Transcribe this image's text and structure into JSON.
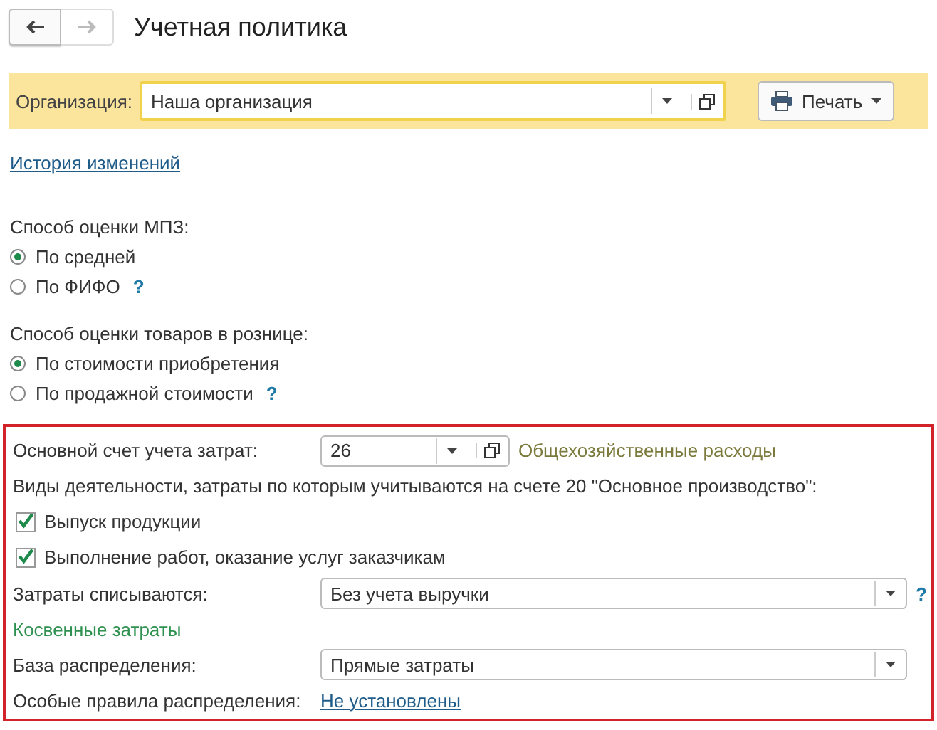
{
  "nav_buttons": [
    {
      "kind": "back",
      "disabled": false
    },
    {
      "kind": "forward",
      "disabled": true
    }
  ],
  "title": "Учетная политика",
  "organization": {
    "label": "Организация:",
    "value": "Наша организация"
  },
  "print_button": "Печать",
  "history_link": "История изменений",
  "inventory_valuation": {
    "label": "Способ оценки МПЗ:",
    "options": [
      {
        "label": "По средней",
        "selected": true
      },
      {
        "label": "По ФИФО",
        "selected": false,
        "help": "?"
      }
    ]
  },
  "retail_valuation": {
    "label": "Способ оценки товаров в рознице:",
    "options": [
      {
        "label": "По стоимости приобретения",
        "selected": true
      },
      {
        "label": "По продажной стоимости",
        "selected": false,
        "help": "?"
      }
    ]
  },
  "costs": {
    "main_account": {
      "label": "Основной счет учета затрат:",
      "value": "26",
      "description": "Общехозяйственные расходы"
    },
    "activities_label": "Виды деятельности, затраты по которым учитываются на счете 20 \"Основное производство\":",
    "activities": [
      {
        "label": "Выпуск продукции",
        "checked": true
      },
      {
        "label": "Выполнение работ, оказание услуг заказчикам",
        "checked": true
      }
    ],
    "write_off": {
      "label": "Затраты списываются:",
      "value": "Без учета выручки",
      "help": "?"
    },
    "indirect_heading": "Косвенные затраты",
    "distribution_base": {
      "label": "База распределения:",
      "value": "Прямые затраты"
    },
    "special_rules": {
      "label": "Особые правила распределения:",
      "link": "Не установлены"
    }
  }
}
